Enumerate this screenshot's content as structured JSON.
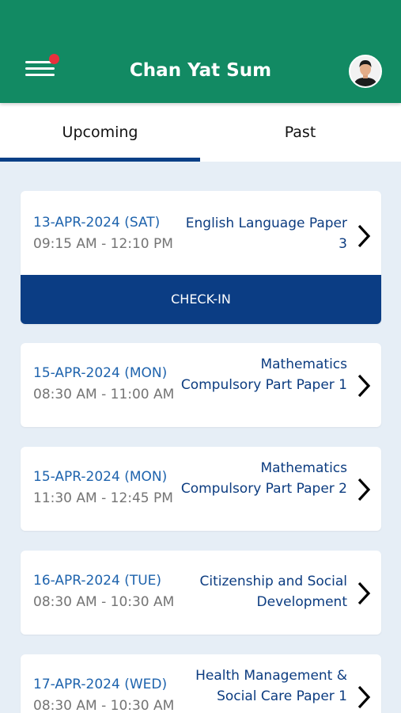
{
  "header": {
    "title": "Chan Yat Sum",
    "brand_color": "#128a63",
    "menu_icon": "hamburger-menu-icon",
    "notification_color": "#e8303d"
  },
  "tabs": [
    {
      "label": "Upcoming",
      "active": true
    },
    {
      "label": "Past",
      "active": false
    }
  ],
  "exams": [
    {
      "date": "13-APR-2024 (SAT)",
      "time": "09:15 AM - 12:10 PM",
      "subject": "English Language Paper 3",
      "action": "CHECK-IN"
    },
    {
      "date": "15-APR-2024 (MON)",
      "time": "08:30 AM - 11:00 AM",
      "subject": "Mathematics Compulsory Part Paper 1"
    },
    {
      "date": "15-APR-2024 (MON)",
      "time": "11:30 AM - 12:45 PM",
      "subject": "Mathematics Compulsory Part Paper 2"
    },
    {
      "date": "16-APR-2024 (TUE)",
      "time": "08:30 AM - 10:30 AM",
      "subject": "Citizenship and Social Development"
    },
    {
      "date": "17-APR-2024 (WED)",
      "time": "08:30 AM - 10:30 AM",
      "subject": "Health Management & Social Care Paper 1"
    }
  ],
  "colors": {
    "date_text": "#1e63ad",
    "subject_text": "#0c3c80",
    "checkin_bg": "#0b3d84",
    "page_bg": "#e6eef6"
  }
}
